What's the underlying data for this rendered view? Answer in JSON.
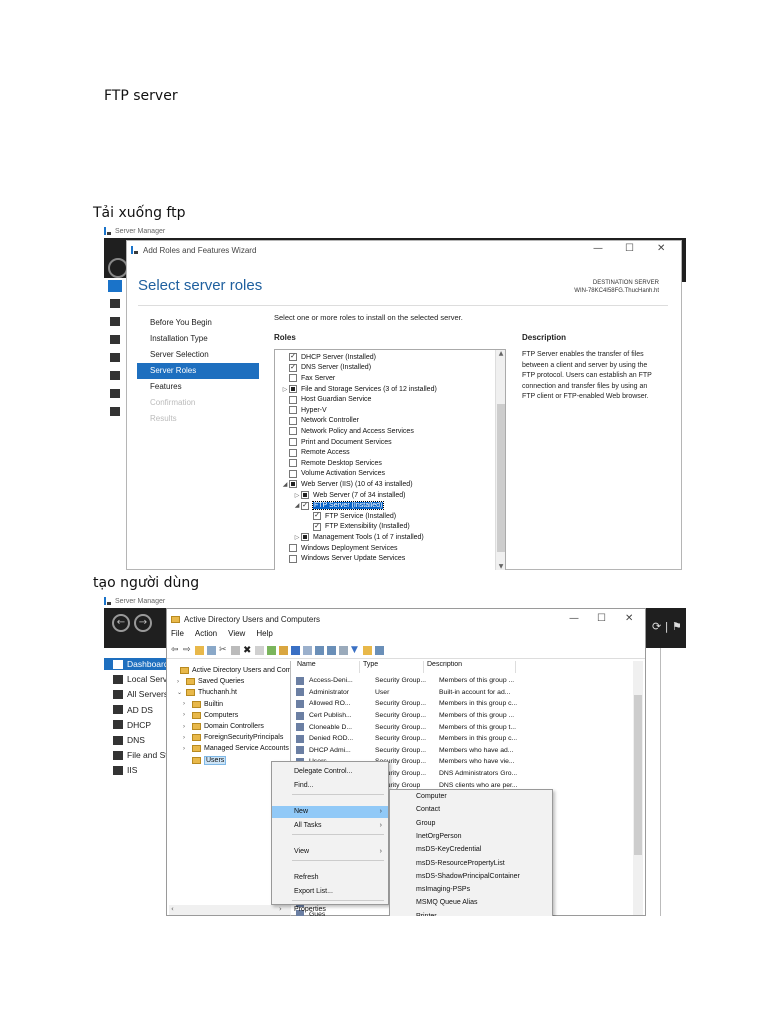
{
  "doc": {
    "heading": "FTP server",
    "section1": "Tải xuống ftp",
    "section2": "tạo người dùng"
  },
  "shot1": {
    "app_title": "Server Manager",
    "window_title": "Add Roles and Features Wizard",
    "heading": "Select server roles",
    "destination_label": "DESTINATION SERVER",
    "destination_value": "WIN-78KC4I58FG.ThucHanh.ht",
    "instruction": "Select one or more roles to install on the selected server.",
    "roles_header": "Roles",
    "description_header": "Description",
    "description": "FTP Server enables the transfer of files between a client and server by using the FTP protocol. Users can establish an FTP connection and transfer files by using an FTP client or FTP-enabled Web browser.",
    "steps": [
      {
        "label": "Before You Begin",
        "state": "normal"
      },
      {
        "label": "Installation Type",
        "state": "normal"
      },
      {
        "label": "Server Selection",
        "state": "normal"
      },
      {
        "label": "Server Roles",
        "state": "active"
      },
      {
        "label": "Features",
        "state": "normal"
      },
      {
        "label": "Confirmation",
        "state": "disabled"
      },
      {
        "label": "Results",
        "state": "disabled"
      }
    ],
    "roles": [
      {
        "label": "DHCP Server (Installed)",
        "check": "checked",
        "indent": 0,
        "toggle": ""
      },
      {
        "label": "DNS Server (Installed)",
        "check": "checked",
        "indent": 0,
        "toggle": ""
      },
      {
        "label": "Fax Server",
        "check": "none",
        "indent": 0,
        "toggle": ""
      },
      {
        "label": "File and Storage Services (3 of 12 installed)",
        "check": "partial",
        "indent": 0,
        "toggle": "▷"
      },
      {
        "label": "Host Guardian Service",
        "check": "none",
        "indent": 0,
        "toggle": ""
      },
      {
        "label": "Hyper-V",
        "check": "none",
        "indent": 0,
        "toggle": ""
      },
      {
        "label": "Network Controller",
        "check": "none",
        "indent": 0,
        "toggle": ""
      },
      {
        "label": "Network Policy and Access Services",
        "check": "none",
        "indent": 0,
        "toggle": ""
      },
      {
        "label": "Print and Document Services",
        "check": "none",
        "indent": 0,
        "toggle": ""
      },
      {
        "label": "Remote Access",
        "check": "none",
        "indent": 0,
        "toggle": ""
      },
      {
        "label": "Remote Desktop Services",
        "check": "none",
        "indent": 0,
        "toggle": ""
      },
      {
        "label": "Volume Activation Services",
        "check": "none",
        "indent": 0,
        "toggle": ""
      },
      {
        "label": "Web Server (IIS) (10 of 43 installed)",
        "check": "partial",
        "indent": 0,
        "toggle": "◢"
      },
      {
        "label": "Web Server (7 of 34 installed)",
        "check": "partial",
        "indent": 1,
        "toggle": "▷"
      },
      {
        "label": "FTP Server (Installed)",
        "check": "checked",
        "indent": 1,
        "toggle": "◢",
        "highlight": true
      },
      {
        "label": "FTP Service (Installed)",
        "check": "checked",
        "indent": 2,
        "toggle": ""
      },
      {
        "label": "FTP Extensibility (Installed)",
        "check": "checked",
        "indent": 2,
        "toggle": ""
      },
      {
        "label": "Management Tools (1 of 7 installed)",
        "check": "partial",
        "indent": 1,
        "toggle": "▷"
      },
      {
        "label": "Windows Deployment Services",
        "check": "none",
        "indent": 0,
        "toggle": ""
      },
      {
        "label": "Windows Server Update Services",
        "check": "none",
        "indent": 0,
        "toggle": ""
      }
    ]
  },
  "shot2": {
    "app_title": "Server Manager",
    "window_title": "Active Directory Users and Computers",
    "menu": [
      "File",
      "Action",
      "View",
      "Help"
    ],
    "sm_nav": [
      {
        "label": "Dashboard",
        "selected": true
      },
      {
        "label": "Local Server",
        "selected": false
      },
      {
        "label": "All Servers",
        "selected": false
      },
      {
        "label": "AD DS",
        "selected": false
      },
      {
        "label": "DHCP",
        "selected": false
      },
      {
        "label": "DNS",
        "selected": false
      },
      {
        "label": "File and Storage Services",
        "selected": false
      },
      {
        "label": "IIS",
        "selected": false
      }
    ],
    "tree": [
      {
        "label": "Active Directory Users and Com",
        "indent": 0,
        "toggle": ""
      },
      {
        "label": "Saved Queries",
        "indent": 1,
        "toggle": "›"
      },
      {
        "label": "Thuchanh.ht",
        "indent": 1,
        "toggle": "⌄"
      },
      {
        "label": "Builtin",
        "indent": 2,
        "toggle": "›"
      },
      {
        "label": "Computers",
        "indent": 2,
        "toggle": "›"
      },
      {
        "label": "Domain Controllers",
        "indent": 2,
        "toggle": "›"
      },
      {
        "label": "ForeignSecurityPrincipals",
        "indent": 2,
        "toggle": "›"
      },
      {
        "label": "Managed Service Accounts",
        "indent": 2,
        "toggle": "›"
      },
      {
        "label": "Users",
        "indent": 2,
        "toggle": "",
        "selected": true
      }
    ],
    "columns": [
      "Name",
      "Type",
      "Description"
    ],
    "rows": [
      [
        "Access-Deni...",
        "Security Group...",
        "Members of this group ..."
      ],
      [
        "Administrator",
        "User",
        "Built-in account for ad..."
      ],
      [
        "Allowed RO...",
        "Security Group...",
        "Members in this group c..."
      ],
      [
        "Cert Publish...",
        "Security Group...",
        "Members of this group ..."
      ],
      [
        "Cloneable D...",
        "Security Group...",
        "Members of this group t..."
      ],
      [
        "Denied ROD...",
        "Security Group...",
        "Members in this group c..."
      ],
      [
        "DHCP Admi...",
        "Security Group...",
        "Members who have ad..."
      ],
      [
        "Users",
        "Security Group...",
        "Members who have vie..."
      ],
      [
        "dmins",
        "Security Group...",
        "DNS Administrators Gro..."
      ],
      [
        "pdateP...",
        "Security Group",
        "DNS clients who are per..."
      ]
    ],
    "partial_right": [
      "trato...",
      "ser...",
      "rs i...",
      "trato...",
      "up ...",
      "up ...",
      "up c...",
      "ique..."
    ],
    "bottom_rows": [
      "Grou",
      "Gues"
    ],
    "context_menu": [
      {
        "label": "Delegate Control...",
        "sub": false
      },
      {
        "label": "Find...",
        "sub": false
      },
      {
        "label": "New",
        "sub": true,
        "highlight": true
      },
      {
        "label": "All Tasks",
        "sub": true
      },
      {
        "label": "View",
        "sub": true
      },
      {
        "label": "Refresh",
        "sub": false
      },
      {
        "label": "Export List...",
        "sub": false
      },
      {
        "label": "Properties",
        "sub": false
      },
      {
        "label": "Help",
        "sub": false
      }
    ],
    "submenu": [
      "Computer",
      "Contact",
      "Group",
      "InetOrgPerson",
      "msDS-KeyCredential",
      "msDS-ResourcePropertyList",
      "msDS-ShadowPrincipalContainer",
      "msImaging-PSPs",
      "MSMQ Queue Alias",
      "Printer"
    ]
  }
}
